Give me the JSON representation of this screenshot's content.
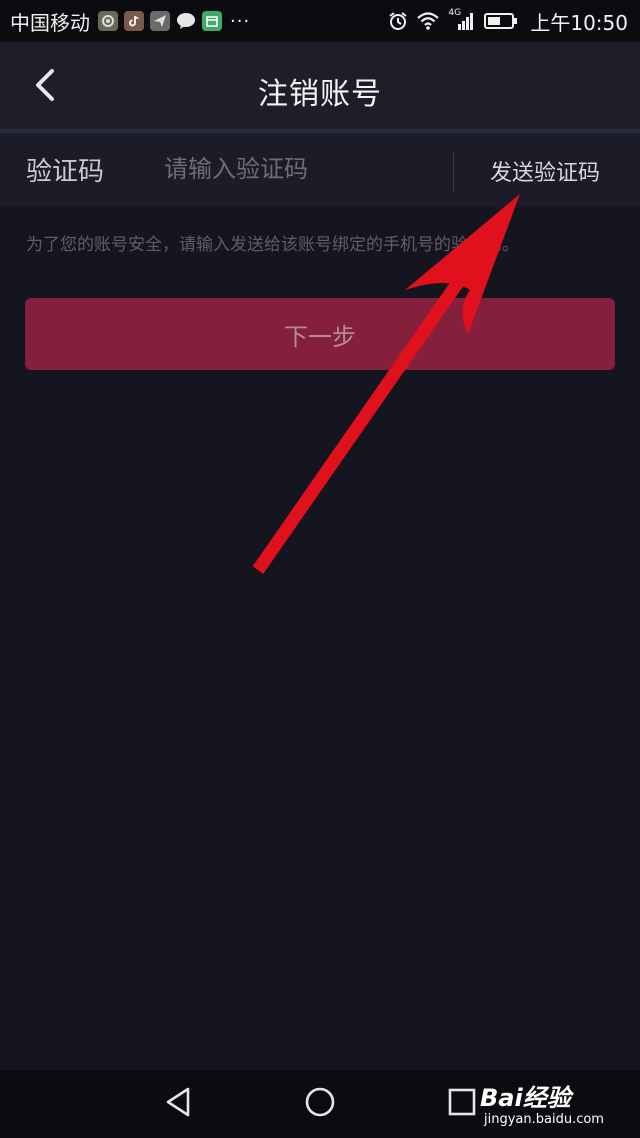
{
  "status_bar": {
    "carrier": "中国移动",
    "more": "···",
    "network": "4G",
    "time": "上午10:50"
  },
  "header": {
    "title": "注销账号"
  },
  "form": {
    "code_label": "验证码",
    "code_placeholder": "请输入验证码",
    "code_value": "",
    "send_code_label": "发送验证码",
    "hint": "为了您的账号安全，请输入发送给该账号绑定的手机号的验证码。"
  },
  "actions": {
    "next_label": "下一步"
  },
  "watermark": {
    "brand": "Bai经验",
    "url": "jingyan.baidu.com"
  },
  "colors": {
    "background": "#15151f",
    "header": "#1d1e29",
    "accent_button": "#841f3c",
    "annotation_arrow": "#e0101c"
  }
}
